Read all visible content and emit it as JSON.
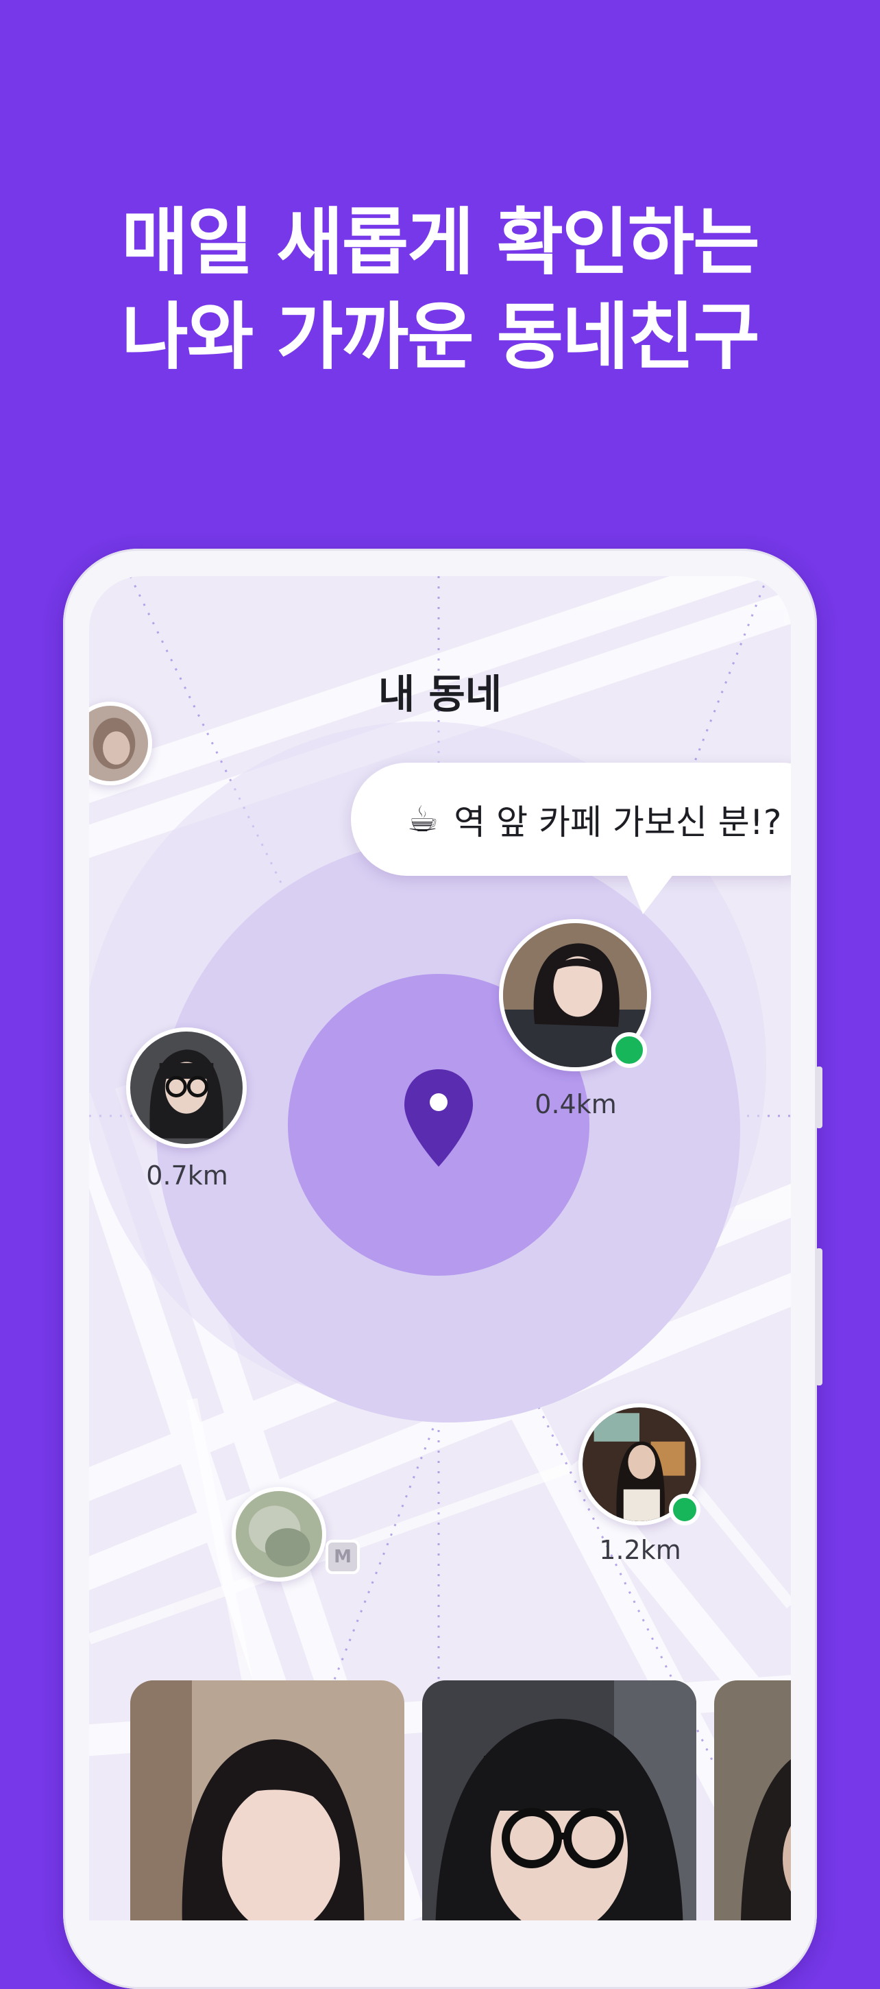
{
  "headline": {
    "line1": "매일 새롭게 확인하는",
    "line2": "나와 가까운 동네친구"
  },
  "screen": {
    "title": "내 동네"
  },
  "bubble": {
    "icon": "coffee-icon",
    "icon_glyph": "☕",
    "text": "역 앞 카페 가보신 분!?"
  },
  "nearby_users": [
    {
      "distance": "0.4km",
      "online": true
    },
    {
      "distance": "0.7km",
      "online": false
    },
    {
      "distance": "1.2km",
      "online": true
    },
    {
      "distance": "",
      "online": false
    },
    {
      "distance": "",
      "online": false
    }
  ],
  "subway_badge": "M",
  "colors": {
    "background": "#7638E8",
    "accent": "#5A2DB0",
    "online": "#17B65A"
  }
}
